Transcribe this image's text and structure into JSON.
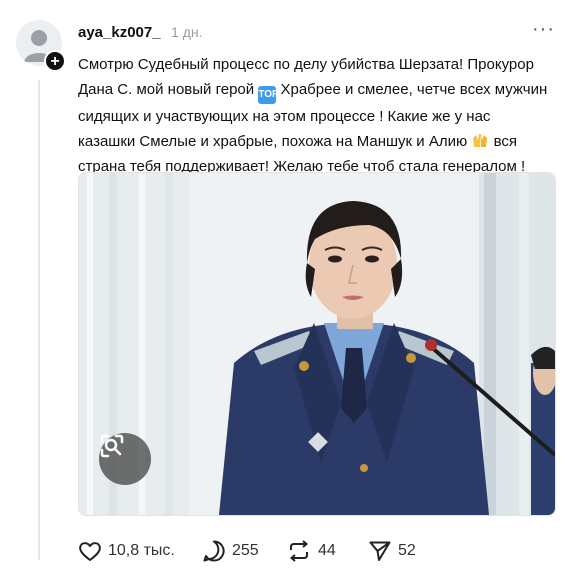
{
  "post": {
    "username": "aya_kz007_",
    "time": "1 дн.",
    "text_lines": [
      "Смотрю Судебный процесс по делу убийства Шерзата! Прокурор",
      "Дана С. мой новый герой",
      "Храбрее и смелее, четче всех мужчин",
      "сидящих и участвующих на этом процессе ! Какие же у нас",
      "казашки Смелые и храбрые, похожа на Маншук и Алию",
      "вся",
      "страна тебя поддерживает! Желаю тебе чтоб стала генералом !"
    ],
    "emoji_top_label": "TOP",
    "image_alt_icon": "lens-icon"
  },
  "actions": {
    "likes": "10,8 тыс.",
    "replies": "255",
    "reposts": "44",
    "shares": "52"
  },
  "icons": {
    "like": "heart-icon",
    "reply": "comment-icon",
    "repost": "repost-icon",
    "share": "send-icon",
    "more": "more-icon"
  },
  "colors": {
    "text": "#111111",
    "muted": "#9a9a9a",
    "uniform": "#2b3a66",
    "shirt": "#7ea6d8"
  }
}
